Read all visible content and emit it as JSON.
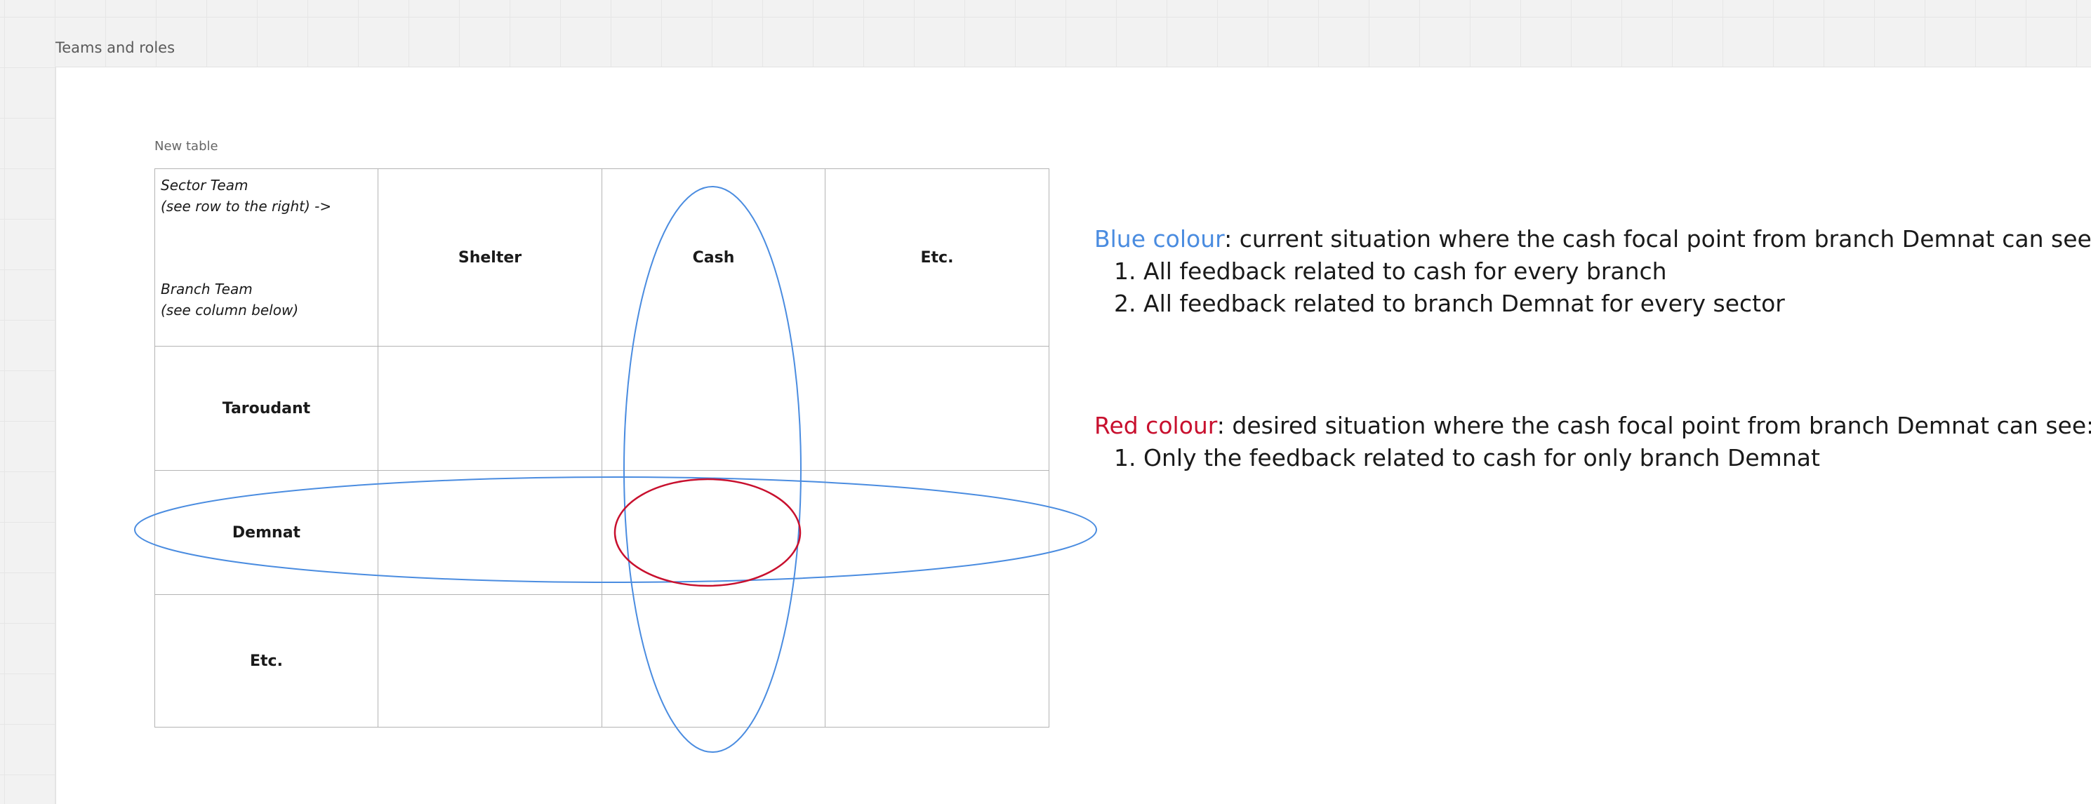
{
  "frame": {
    "title": "Teams and roles"
  },
  "table": {
    "caption": "New table",
    "corner": {
      "line1": "Sector Team",
      "line2": "(see row to the right) ->",
      "line3": "Branch Team",
      "line4": "(see column below)"
    },
    "columns": [
      "Shelter",
      "Cash",
      "Etc."
    ],
    "rows": [
      "Taroudant",
      "Demnat",
      "Etc."
    ]
  },
  "notes": {
    "blue": {
      "keyword": "Blue colour",
      "text": ": current situation where the cash focal point from branch Demnat can see:",
      "items": [
        "All feedback related to cash for every branch",
        "All feedback related to branch Demnat for every sector"
      ]
    },
    "red": {
      "keyword": "Red colour",
      "text": ": desired situation where the cash focal point from branch Demnat can see:",
      "items": [
        "Only the feedback related to cash for only branch Demnat"
      ]
    }
  },
  "colors": {
    "blue": "#4a8ce0",
    "red": "#c8102e",
    "grid": "#b4b4b4"
  }
}
